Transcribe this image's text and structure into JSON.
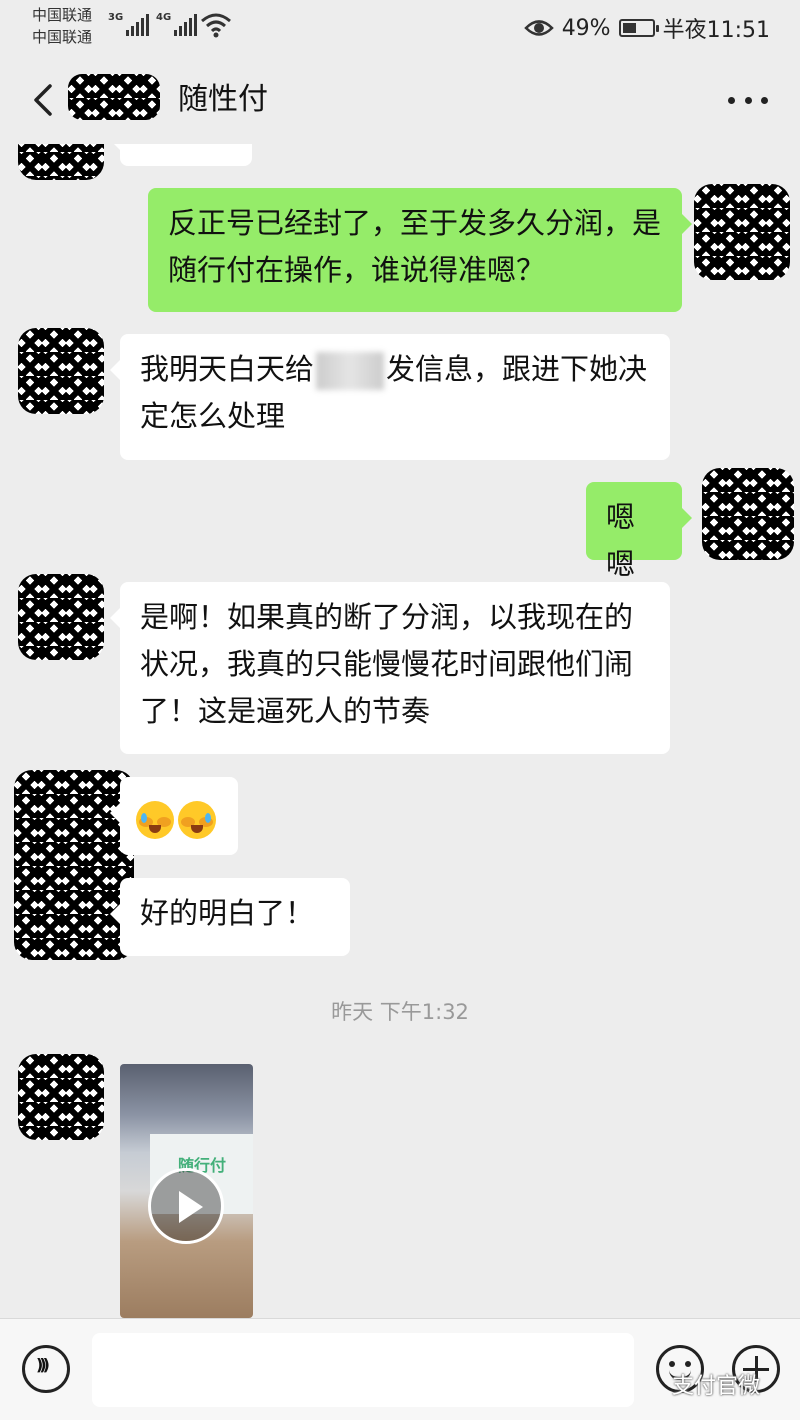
{
  "status_bar": {
    "carrier_1": "中国联通",
    "carrier_2": "中国联通",
    "net_1": "3G",
    "net_2": "4G",
    "battery_percent": "49%",
    "battery_level": 0.49,
    "time": "半夜11:51"
  },
  "header": {
    "title": "随性付"
  },
  "messages": {
    "m1": "反正号已经封了，至于发多久分润，是随行付在操作，谁说得准嗯？",
    "m2_before": "我明天白天给",
    "m2_after": "发信息，跟进下她决定怎么处理",
    "m3": "嗯嗯",
    "m4": "是啊！如果真的断了分润，以我现在的状况，我真的只能慢慢花时间跟他们闹了！这是逼死人的节奏",
    "m6": "好的明白了！",
    "timestamp": "昨天 下午1:32",
    "video_logo": "随行付"
  },
  "watermark": "支付官微"
}
